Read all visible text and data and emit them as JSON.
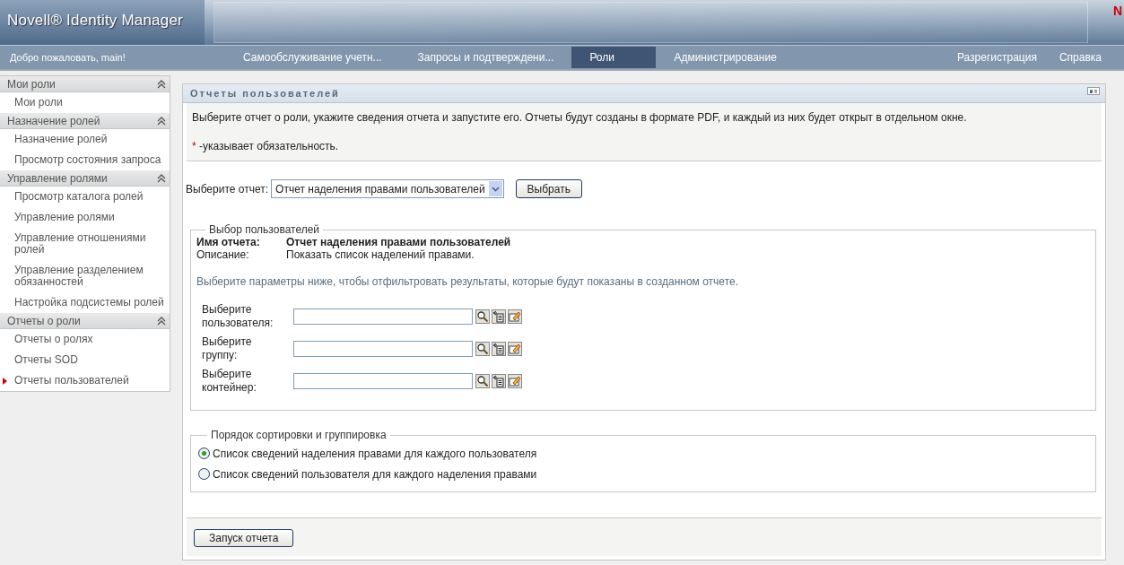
{
  "header": {
    "title": "Novell® Identity Manager",
    "logo_mark": "N"
  },
  "nav": {
    "welcome": "Добро пожаловать, main!",
    "items": [
      {
        "label": "Самообслуживание учетн...",
        "selected": false
      },
      {
        "label": "Запросы и подтверждени...",
        "selected": false
      },
      {
        "label": "Роли",
        "selected": true
      },
      {
        "label": "Администрирование",
        "selected": false
      }
    ],
    "right_links": [
      "Разрегистрация",
      "Справка"
    ]
  },
  "sidebar": {
    "groups": [
      {
        "title": "Мои роли",
        "expanded": true,
        "items": [
          {
            "label": "Мои роли",
            "selected": false
          }
        ]
      },
      {
        "title": "Назначение ролей",
        "expanded": true,
        "items": [
          {
            "label": "Назначение ролей",
            "selected": false
          },
          {
            "label": "Просмотр состояния запроса",
            "selected": false
          }
        ]
      },
      {
        "title": "Управление ролями",
        "expanded": true,
        "items": [
          {
            "label": "Просмотр каталога ролей",
            "selected": false
          },
          {
            "label": "Управление ролями",
            "selected": false
          },
          {
            "label": "Управление отношениями ролей",
            "selected": false
          },
          {
            "label": "Управление разделением обязанностей",
            "selected": false
          },
          {
            "label": "Настройка подсистемы ролей",
            "selected": false
          }
        ]
      },
      {
        "title": "Отчеты о роли",
        "expanded": true,
        "items": [
          {
            "label": "Отчеты о ролях",
            "selected": false
          },
          {
            "label": "Отчеты SOD",
            "selected": false
          },
          {
            "label": "Отчеты пользователей",
            "selected": true
          }
        ]
      }
    ]
  },
  "panel": {
    "title": "Отчеты пользователей",
    "intro": "Выберите отчет о роли, укажите сведения отчета и запустите его. Отчеты будут созданы в формате PDF, и каждый из них будет открыт в отдельном окне.",
    "required_mark": "*",
    "required_text": "-указывает обязательность.",
    "report_select": {
      "label": "Выберите отчет:",
      "value": "Отчет наделения правами пользователей",
      "button": "Выбрать"
    },
    "user_selection": {
      "legend": "Выбор пользователей",
      "name_label": "Имя отчета:",
      "name_value": "Отчет наделения правами пользователей",
      "desc_label": "Описание:",
      "desc_value": "Показать список наделений правами.",
      "hint": "Выберите параметры ниже, чтобы отфильтровать результаты, которые будут показаны в созданном отчете.",
      "fields": [
        {
          "label": "Выберите пользователя:"
        },
        {
          "label": "Выберите группу:"
        },
        {
          "label": "Выберите контейнер:"
        }
      ]
    },
    "sorting": {
      "legend": "Порядок сортировки и группировка",
      "options": [
        {
          "label": "Список сведений наделения правами для каждого пользователя",
          "selected": true
        },
        {
          "label": "Список сведений пользователя для каждого наделения правами",
          "selected": false
        }
      ]
    },
    "run_button": "Запуск отчета"
  }
}
